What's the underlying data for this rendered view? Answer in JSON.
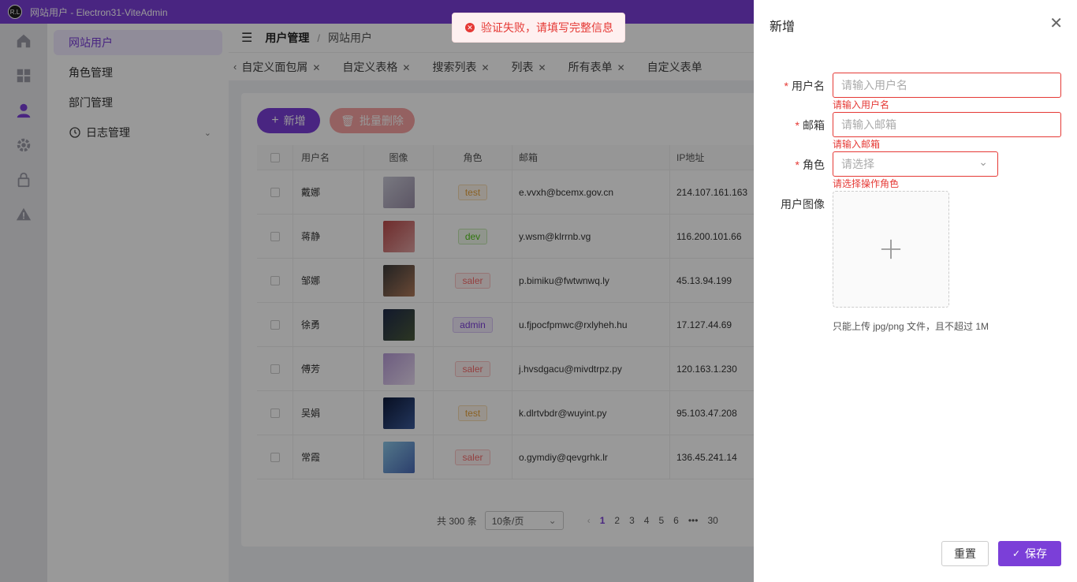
{
  "window": {
    "title": "网站用户 - Electron31-ViteAdmin",
    "logo_text": "R.L"
  },
  "iconbar": {
    "items": [
      "home-icon",
      "dashboard-icon",
      "user-icon",
      "gear-icon",
      "lock-icon",
      "warning-icon"
    ],
    "active": 2
  },
  "submenu": {
    "items": [
      {
        "label": "网站用户"
      },
      {
        "label": "角色管理"
      },
      {
        "label": "部门管理"
      },
      {
        "label": "日志管理"
      }
    ]
  },
  "breadcrumb": {
    "parent": "用户管理",
    "sep": "/",
    "current": "网站用户"
  },
  "tabs": [
    "自定义面包屑",
    "自定义表格",
    "搜索列表",
    "列表",
    "所有表单",
    "自定义表单"
  ],
  "toolbar": {
    "add_label": "新增",
    "batch_delete_label": "批量删除"
  },
  "table": {
    "headers": [
      "用户名",
      "图像",
      "角色",
      "邮箱",
      "IP地址"
    ],
    "rows": [
      {
        "name": "戴娜",
        "role": "test",
        "email": "e.vvxh@bcemx.gov.cn",
        "ip": "214.107.161.163"
      },
      {
        "name": "蒋静",
        "role": "dev",
        "email": "y.wsm@klrrnb.vg",
        "ip": "116.200.101.66"
      },
      {
        "name": "邹娜",
        "role": "saler",
        "email": "p.bimiku@fwtwnwq.ly",
        "ip": "45.13.94.199"
      },
      {
        "name": "徐勇",
        "role": "admin",
        "email": "u.fjpocfpmwc@rxlyheh.hu",
        "ip": "17.127.44.69"
      },
      {
        "name": "傅芳",
        "role": "saler",
        "email": "j.hvsdgacu@mivdtrpz.py",
        "ip": "120.163.1.230"
      },
      {
        "name": "吴娟",
        "role": "test",
        "email": "k.dlrtvbdr@wuyint.py",
        "ip": "95.103.47.208"
      },
      {
        "name": "常霞",
        "role": "saler",
        "email": "o.gymdiy@qevgrhk.lr",
        "ip": "136.45.241.14"
      }
    ]
  },
  "role_colors": {
    "test": {
      "fg": "#e6a23c",
      "bg": "#fdf6ec",
      "bd": "#f5dab1"
    },
    "dev": {
      "fg": "#52c41a",
      "bg": "#f0f9eb",
      "bd": "#c2e7b0"
    },
    "saler": {
      "fg": "#f56c6c",
      "bg": "#fef0f0",
      "bd": "#fbc4c4"
    },
    "admin": {
      "fg": "#7b3fd8",
      "bg": "#f2ebfc",
      "bd": "#d7c3f5"
    }
  },
  "pagination": {
    "total": "共 300 条",
    "page_size": "10条/页",
    "pages": [
      "1",
      "2",
      "3",
      "4",
      "5",
      "6"
    ],
    "more": "•••",
    "last": "30"
  },
  "toast": {
    "message": "验证失败，请填写完整信息"
  },
  "drawer": {
    "title": "新增",
    "fields": {
      "username": {
        "label": "用户名",
        "placeholder": "请输入用户名",
        "error": "请输入用户名"
      },
      "email": {
        "label": "邮箱",
        "placeholder": "请输入邮箱",
        "error": "请输入邮箱"
      },
      "role": {
        "label": "角色",
        "placeholder": "请选择",
        "error": "请选择操作角色"
      },
      "avatar": {
        "label": "用户图像",
        "tip": "只能上传 jpg/png 文件，且不超过 1M"
      }
    },
    "reset_label": "重置",
    "save_label": "保存"
  }
}
